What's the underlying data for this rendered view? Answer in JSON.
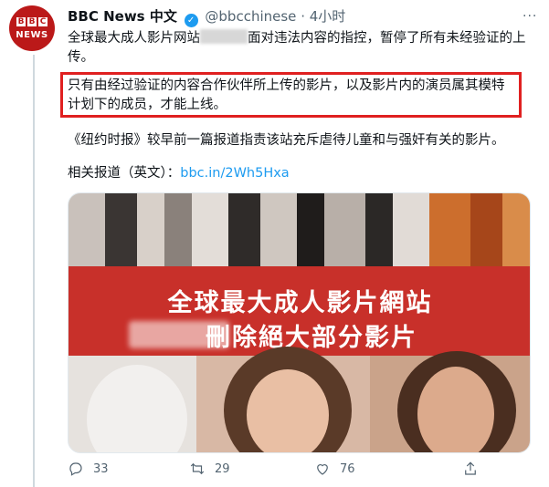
{
  "tweet": {
    "author_name": "BBC News 中文",
    "verified_mark": "✓",
    "handle": "@bbcchinese",
    "separator": "·",
    "time": "4小时",
    "more": "···",
    "avatar": {
      "logo_letters": [
        "B",
        "B",
        "C"
      ],
      "logo_word": "NEWS"
    },
    "para1_a": "全球最大成人影片网站",
    "para1_b": "面对违法内容的指控，暂停了所有未经验证的上传。",
    "para2": "只有由经过验证的内容合作伙伴所上传的影片，以及影片内的演员属其模特计划下的成员，才能上线。",
    "para3": "《纽约时报》较早前一篇报道指责该站充斥虐待儿童和与强奸有关的影片。",
    "para4_label": "相关报道（英文）：",
    "para4_link": "bbc.in/2Wh5Hxa",
    "media": {
      "line1": "全球最大成人影片網站",
      "line2": "刪除絕大部分影片"
    },
    "actions": {
      "reply_count": "33",
      "retweet_count": "29",
      "like_count": "76"
    }
  },
  "colors": {
    "highlight_border": "#e02020",
    "link": "#1d9bf0",
    "brand_red": "#bb1919",
    "band_red": "#c8302a"
  },
  "icons": [
    "reply-icon",
    "retweet-icon",
    "like-icon",
    "share-icon",
    "verified-icon",
    "more-icon"
  ]
}
